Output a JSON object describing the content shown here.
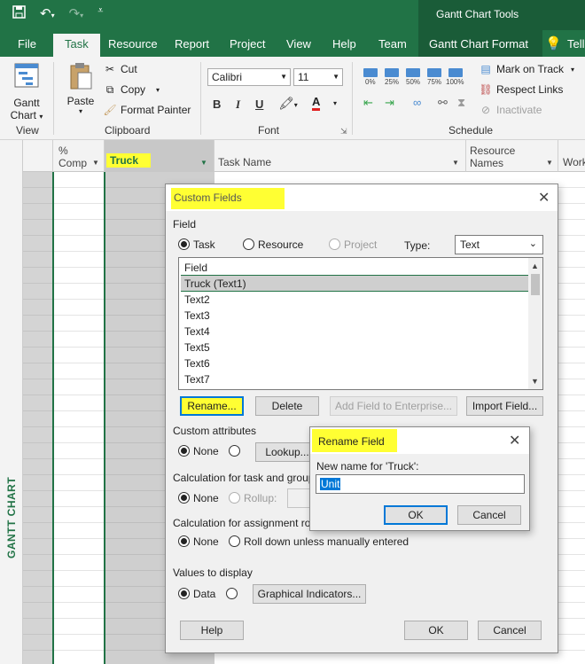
{
  "titlebar": {
    "contextual_title": "Gantt Chart Tools"
  },
  "tabs": {
    "file": "File",
    "task": "Task",
    "resource": "Resource",
    "report": "Report",
    "project": "Project",
    "view": "View",
    "help": "Help",
    "team": "Team",
    "gantt_format": "Gantt Chart Format",
    "tell": "Tell"
  },
  "ribbon": {
    "view_group": {
      "gantt_chart_line1": "Gantt",
      "gantt_chart_line2": "Chart",
      "label": "View"
    },
    "clipboard": {
      "paste": "Paste",
      "cut": "Cut",
      "copy": "Copy",
      "format_painter": "Format Painter",
      "label": "Clipboard"
    },
    "font": {
      "family": "Calibri",
      "size": "11",
      "bold": "B",
      "italic": "I",
      "underline": "U",
      "font_color": "A",
      "label": "Font"
    },
    "schedule": {
      "pct_labels": [
        "0%",
        "25%",
        "50%",
        "75%",
        "100%"
      ],
      "mark_on_track": "Mark on Track",
      "respect_links": "Respect Links",
      "inactivate": "Inactivate",
      "label": "Schedule"
    }
  },
  "grid": {
    "col_pct_line1": "%",
    "col_pct_line2": "Comp",
    "col_truck": "Truck",
    "col_task_name": "Task Name",
    "col_resource_line1": "Resource",
    "col_resource_line2": "Names",
    "col_work": "Work",
    "sidebar_label": "GANTT CHART"
  },
  "custom_fields": {
    "title": "Custom Fields",
    "field_label": "Field",
    "radio_task": "Task",
    "radio_resource": "Resource",
    "radio_project": "Project",
    "type_label": "Type:",
    "type_value": "Text",
    "list_header": "Field",
    "items": [
      "Truck (Text1)",
      "Text2",
      "Text3",
      "Text4",
      "Text5",
      "Text6",
      "Text7"
    ],
    "rename_btn": "Rename...",
    "delete_btn": "Delete",
    "add_enterprise_btn": "Add Field to Enterprise...",
    "import_btn": "Import Field...",
    "custom_attributes": "Custom attributes",
    "none": "None",
    "lookup_btn": "Lookup...",
    "calc_task_group": "Calculation for task and group",
    "rollup": "Rollup:",
    "calc_assignment": "Calculation for assignment ro",
    "roll_down": "Roll down unless manually entered",
    "values_display": "Values to display",
    "data": "Data",
    "graphical_btn": "Graphical Indicators...",
    "help_btn": "Help",
    "ok_btn": "OK",
    "cancel_btn": "Cancel"
  },
  "rename_field": {
    "title": "Rename Field",
    "prompt": "New name for 'Truck':",
    "value": "Unit",
    "ok_btn": "OK",
    "cancel_btn": "Cancel"
  },
  "colors": {
    "accent": "#217346",
    "highlight": "#ffff33",
    "focus": "#0078d7"
  }
}
